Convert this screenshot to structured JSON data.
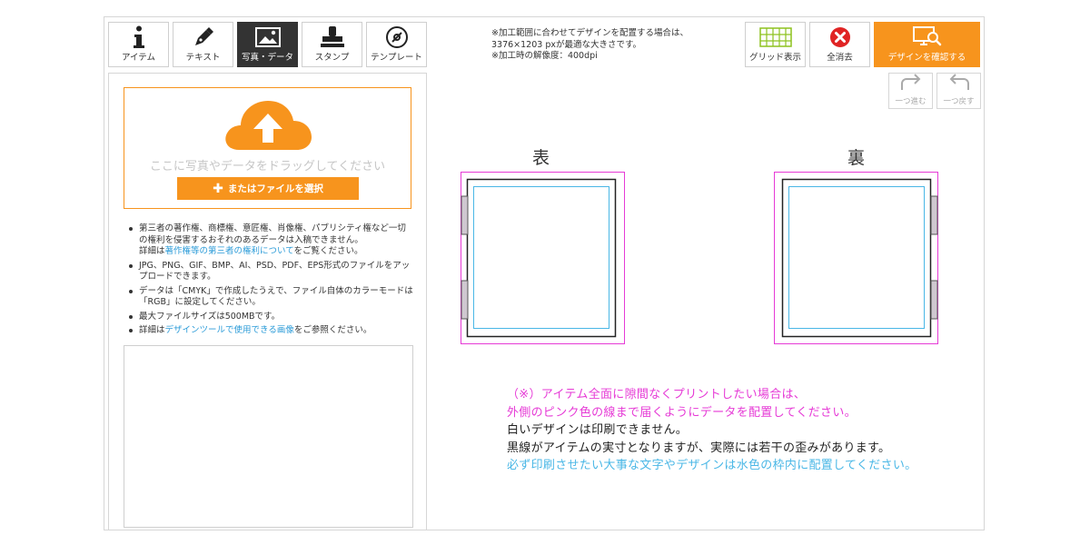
{
  "tabs": [
    {
      "label": "アイテム",
      "icon": "info-icon"
    },
    {
      "label": "テキスト",
      "icon": "pen-icon"
    },
    {
      "label": "写真・データ",
      "icon": "image-icon",
      "active": true
    },
    {
      "label": "スタンプ",
      "icon": "stamp-icon"
    },
    {
      "label": "テンプレート",
      "icon": "template-icon"
    }
  ],
  "top_notes": [
    "※加工範囲に合わせてデザインを配置する場合は、",
    "3376×1203 pxが最適な大きさです。",
    "※加工時の解像度：400dpi"
  ],
  "actions": {
    "grid_label": "グリッド表示",
    "clear_label": "全消去",
    "confirm_label": "デザインを確認する",
    "redo_label": "一つ進む",
    "undo_label": "一つ戻す"
  },
  "upload": {
    "drop_text": "ここに写真やデータをドラッグしてください",
    "select_label": "またはファイルを選択"
  },
  "rules": {
    "r1_text": "第三者の著作権、商標権、意匠権、肖像権、パブリシティ権など一切の権利を侵害するおそれのあるデータは入稿できません。",
    "r1_prefix": "詳細は",
    "r1_link": "著作権等の第三者の権利について",
    "r1_suffix": "をご覧ください。",
    "r2_text": "JPG、PNG、GIF、BMP、AI、PSD、PDF、EPS形式のファイルをアップロードできます。",
    "r3_text": "データは「CMYK」で作成したうえで、ファイル自体のカラーモードは「RGB」に設定してください。",
    "r4_text": "最大ファイルサイズは500MBです。",
    "r5_prefix": "詳細は",
    "r5_link": "デザインツールで使用できる画像",
    "r5_suffix": "をご参照ください。"
  },
  "design": {
    "front_label": "表",
    "back_label": "裏"
  },
  "bottom_notes": {
    "line1": "（※）アイテム全面に隙間なくプリントしたい場合は、",
    "line2": "外側のピンク色の線まで届くようにデータを配置してください。",
    "line3": "白いデザインは印刷できません。",
    "line4": "黒線がアイテムの実寸となりますが、実際には若干の歪みがあります。",
    "line5": "必ず印刷させたい大事な文字やデザインは水色の枠内に配置してください。"
  },
  "colors": {
    "accent": "#f7941d",
    "bleed_line": "#e63ad6",
    "safe_line": "#4ab7e6",
    "link": "#2b9bd8",
    "clear_icon": "#e02424"
  }
}
